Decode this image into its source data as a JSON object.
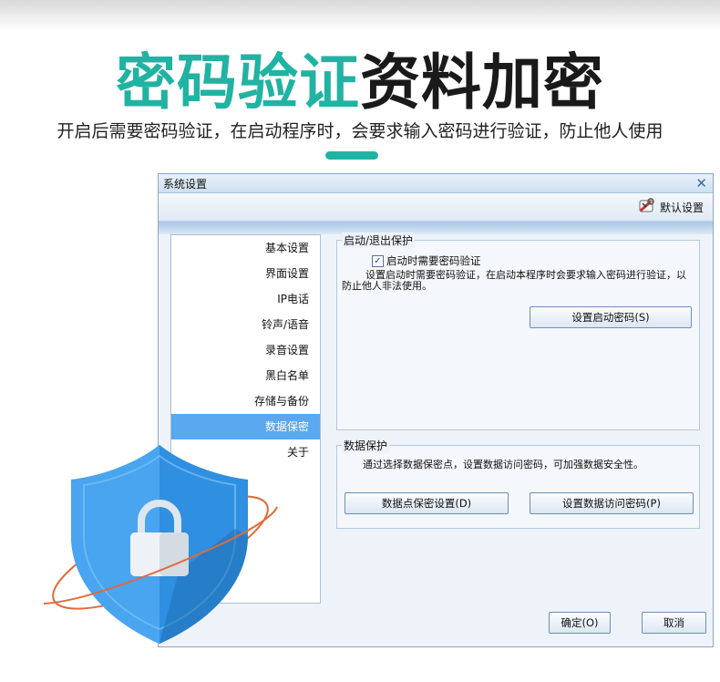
{
  "headline": {
    "teal": "密码验证",
    "dark": "资料加密"
  },
  "subheadline": "开启后需要密码验证，在启动程序时，会要求输入密码进行验证，防止他人使用",
  "window": {
    "title": "系统设置",
    "close_icon": "close-icon",
    "toolbar": {
      "default_settings_label": "默认设置",
      "default_settings_icon": "wrench-tools-icon"
    }
  },
  "nav": {
    "items": [
      {
        "label": "基本设置"
      },
      {
        "label": "界面设置"
      },
      {
        "label": "IP电话"
      },
      {
        "label": "铃声/语音"
      },
      {
        "label": "录音设置"
      },
      {
        "label": "黑白名单"
      },
      {
        "label": "存储与备份"
      },
      {
        "label": "数据保密"
      },
      {
        "label": "关于"
      }
    ],
    "active_index": 7
  },
  "startup_group": {
    "legend": "启动/退出保护",
    "checkbox_label": "启动时需要密码验证",
    "checkbox_checked": true,
    "description": "设置启动时需要密码验证，在启动本程序时会要求输入密码进行验证，以防止他人非法使用。",
    "set_password_button": "设置启动密码(S)"
  },
  "data_group": {
    "legend": "数据保护",
    "description": "通过选择数据保密点，设置数据访问密码，可加强数据安全性。",
    "point_button": "数据点保密设置(D)",
    "access_button": "设置数据访问密码(P)"
  },
  "footer": {
    "ok_button": "确定(O)",
    "cancel_button": "取消"
  },
  "colors": {
    "accent_teal": "#20b3a2",
    "nav_active": "#5aa8ef",
    "shield_blue": "#2f8fe0",
    "orbit_orange": "#e06a3a"
  }
}
